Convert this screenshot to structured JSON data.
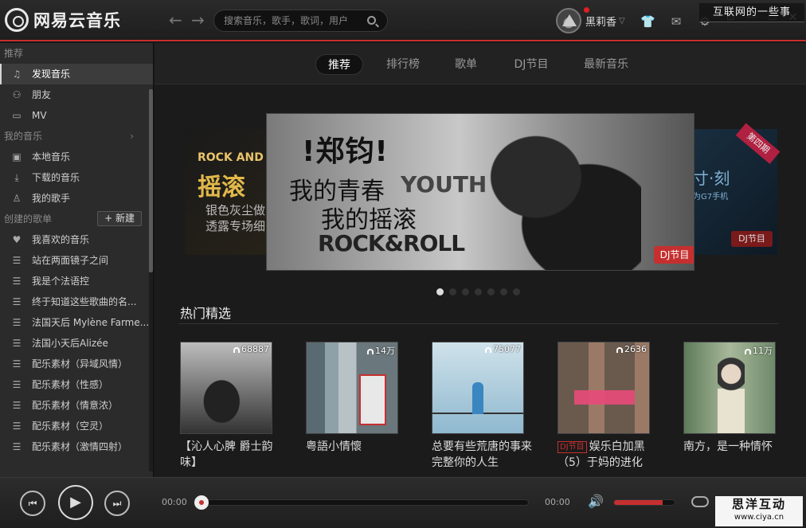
{
  "app": {
    "logo_text": "网易云音乐"
  },
  "search": {
    "placeholder": "搜索音乐，歌手，歌词，用户"
  },
  "user": {
    "name": "黑莉香"
  },
  "watermarks": {
    "top": "互联网的一些事",
    "bottom_title": "思洋互动",
    "bottom_url": "www.ciya.cn"
  },
  "sidebar": {
    "recommend_header": "推荐",
    "recommend_items": [
      {
        "label": "发现音乐",
        "icon": "♫"
      },
      {
        "label": "朋友",
        "icon": "⚇"
      },
      {
        "label": "MV",
        "icon": "▭"
      }
    ],
    "my_music_header": "我的音乐",
    "my_music_items": [
      {
        "label": "本地音乐",
        "icon": "▣"
      },
      {
        "label": "下载的音乐",
        "icon": "⤓"
      },
      {
        "label": "我的歌手",
        "icon": "♙"
      }
    ],
    "created_header": "创建的歌单",
    "new_button": "+ 新建",
    "playlists": [
      {
        "label": "我喜欢的音乐",
        "icon": "♥"
      },
      {
        "label": "站在两面镜子之间",
        "icon": "☰"
      },
      {
        "label": "我是个法语控",
        "icon": "☰"
      },
      {
        "label": "终于知道这些歌曲的名...",
        "icon": "☰"
      },
      {
        "label": "法国天后 Mylène Farme...",
        "icon": "☰"
      },
      {
        "label": "法国小天后Alizée",
        "icon": "☰"
      },
      {
        "label": "配乐素材（异域风情）",
        "icon": "☰"
      },
      {
        "label": "配乐素材（性感）",
        "icon": "☰"
      },
      {
        "label": "配乐素材（情意浓）",
        "icon": "☰"
      },
      {
        "label": "配乐素材（空灵）",
        "icon": "☰"
      },
      {
        "label": "配乐素材（激情四射）",
        "icon": "☰"
      }
    ]
  },
  "tabs": [
    "推荐",
    "排行榜",
    "歌单",
    "DJ节目",
    "最新音乐"
  ],
  "banner": {
    "left_line1": "ROCK AND ROLL",
    "left_line2": "摇滚",
    "left_line3": "银色灰尘做",
    "left_line4": "透露专场细",
    "main_title": "!郑钧!",
    "main_line1": "我的青春",
    "main_line2": "我的摇滚",
    "main_youth": "YOUTH",
    "main_rock": "ROCK&ROLL",
    "main_badge": "DJ节目",
    "right_corner": "第四期",
    "right_title": "寸·刻",
    "right_sub": "为G7手机",
    "right_badge": "DJ节目",
    "dot_count": 7,
    "active_dot": 0
  },
  "hot": {
    "title": "热门精选",
    "cards": [
      {
        "count": "68887",
        "title": "【沁人心脾 爵士韵味】",
        "dj": ""
      },
      {
        "count": "14万",
        "title": "粤語小情懷",
        "dj": ""
      },
      {
        "count": "75077",
        "title": "总要有些荒唐的事来完整你的人生",
        "dj": ""
      },
      {
        "count": "2636",
        "title": "娱乐白加黑（5）于妈的进化",
        "dj": "DJ节目"
      },
      {
        "count": "11万",
        "title": "南方，是一种情怀",
        "dj": ""
      }
    ]
  },
  "player": {
    "elapsed": "00:00",
    "total": "00:00",
    "progress": 0,
    "volume": 0.8
  },
  "colors": {
    "accent": "#c62f2f"
  }
}
